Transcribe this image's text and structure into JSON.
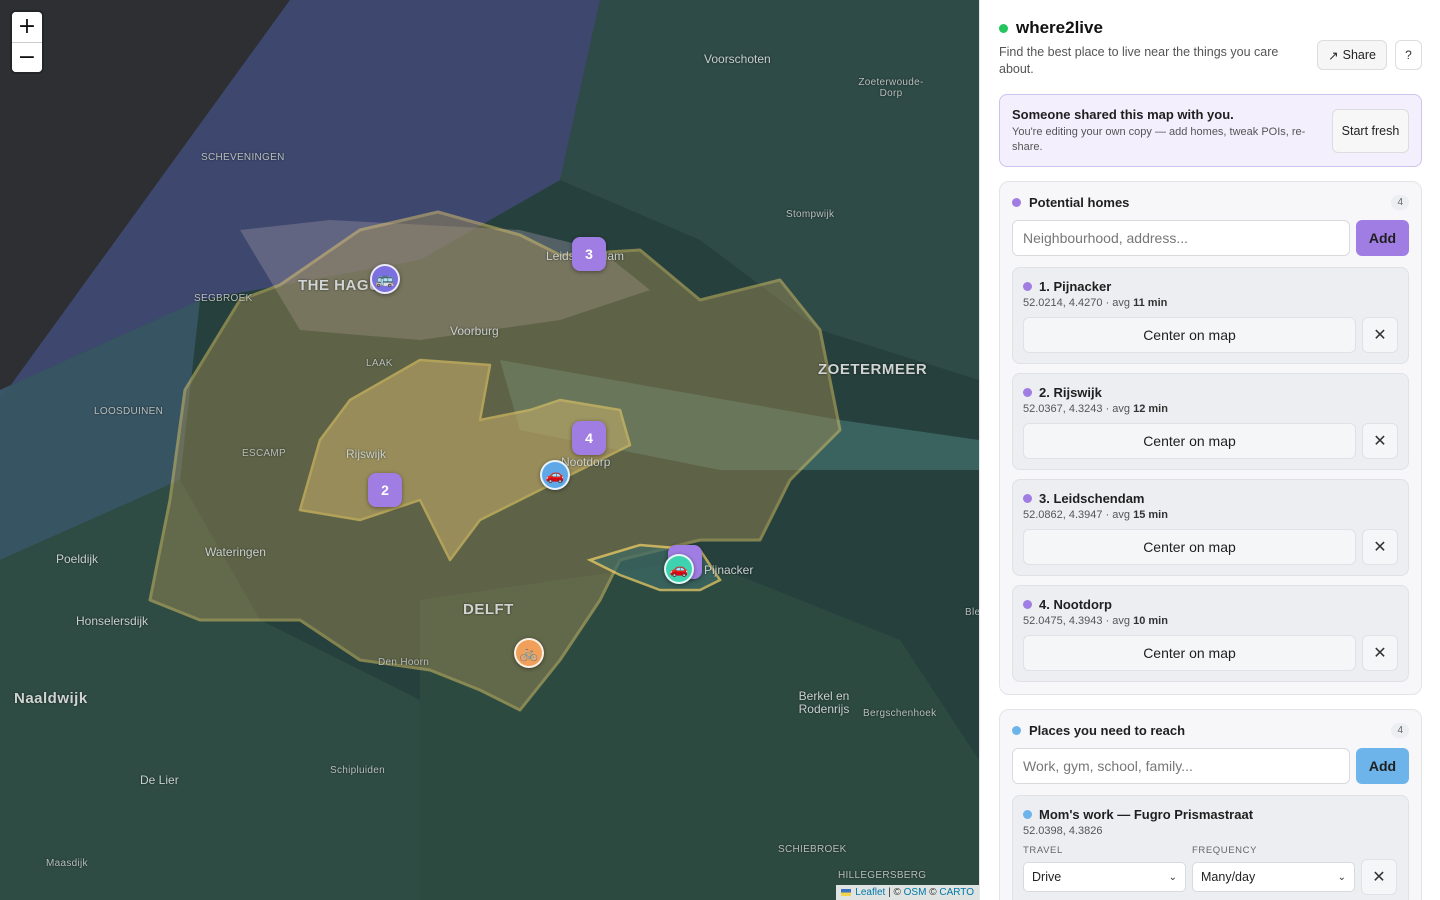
{
  "map": {
    "zoom_in": "+",
    "zoom_out": "−",
    "places": [
      {
        "name": "SCHEVENINGEN",
        "cls": "small"
      },
      {
        "name": "THE HAGUE",
        "cls": "big"
      },
      {
        "name": "SEGBROEK",
        "cls": "small"
      },
      {
        "name": "Voorburg",
        "cls": ""
      },
      {
        "name": "LAAK",
        "cls": "small"
      },
      {
        "name": "Leidschendam",
        "cls": ""
      },
      {
        "name": "Voorschoten",
        "cls": ""
      },
      {
        "name": "Zoeterwoude-Dorp",
        "cls": "small"
      },
      {
        "name": "Stompwijk",
        "cls": "small"
      },
      {
        "name": "ZOETERMEER",
        "cls": "big"
      },
      {
        "name": "LOOSDUINEN",
        "cls": "small"
      },
      {
        "name": "ESCAMP",
        "cls": "small"
      },
      {
        "name": "Rijswijk",
        "cls": ""
      },
      {
        "name": "Nootdorp",
        "cls": ""
      },
      {
        "name": "Wateringen",
        "cls": ""
      },
      {
        "name": "Poeldijk",
        "cls": ""
      },
      {
        "name": "Honselersdijk",
        "cls": ""
      },
      {
        "name": "DELFT",
        "cls": "big"
      },
      {
        "name": "Pijnacker",
        "cls": ""
      },
      {
        "name": "Den Hoorn",
        "cls": "small"
      },
      {
        "name": "Naaldwijk",
        "cls": "big"
      },
      {
        "name": "De Lier",
        "cls": ""
      },
      {
        "name": "Schipluiden",
        "cls": "small"
      },
      {
        "name": "Berkel en Rodenrijs",
        "cls": ""
      },
      {
        "name": "Bergschenhoek",
        "cls": "small"
      },
      {
        "name": "Maasdijk",
        "cls": "small"
      },
      {
        "name": "SCHIEBROEK",
        "cls": "small"
      },
      {
        "name": "HILLEGERSBERG",
        "cls": "small"
      },
      {
        "name": "Ble",
        "cls": "small"
      }
    ],
    "home_markers": [
      "3",
      "2",
      "4"
    ],
    "poi_icons": [
      "bus-icon",
      "car-icon",
      "car-icon",
      "bicycle-icon"
    ],
    "attribution": {
      "leaflet": "Leaflet",
      "sep": " | © ",
      "osm": "OSM",
      "mid": " © ",
      "carto": "CARTO"
    }
  },
  "app": {
    "title": "where2live",
    "tagline": "Find the best place to live near the things you care about.",
    "share_label": "Share",
    "help_label": "?",
    "shared_banner": {
      "title": "Someone shared this map with you.",
      "body": "You're editing your own copy — add homes, tweak POIs, re-share.",
      "button": "Start fresh"
    }
  },
  "homes": {
    "title": "Potential homes",
    "count": "4",
    "placeholder": "Neighbourhood, address...",
    "add_label": "Add",
    "accent": "#a07de3",
    "items": [
      {
        "name": "1. Pijnacker",
        "coords": "52.0214, 4.4270",
        "avg": "11 min"
      },
      {
        "name": "2. Rijswijk",
        "coords": "52.0367, 4.3243",
        "avg": "12 min"
      },
      {
        "name": "3. Leidschendam",
        "coords": "52.0862, 4.3947",
        "avg": "15 min"
      },
      {
        "name": "4. Nootdorp",
        "coords": "52.0475, 4.3943",
        "avg": "10 min"
      }
    ],
    "center_label": "Center on map",
    "avg_prefix": " · avg "
  },
  "places": {
    "title": "Places you need to reach",
    "count": "4",
    "placeholder": "Work, gym, school, family...",
    "add_label": "Add",
    "accent": "#6cb4ea",
    "travel_label": "TRAVEL",
    "frequency_label": "FREQUENCY",
    "items": [
      {
        "name": "Mom's work — Fugro Prismastraat",
        "coords": "52.0398, 4.3826",
        "travel": "Drive",
        "frequency": "Many/day"
      }
    ]
  }
}
